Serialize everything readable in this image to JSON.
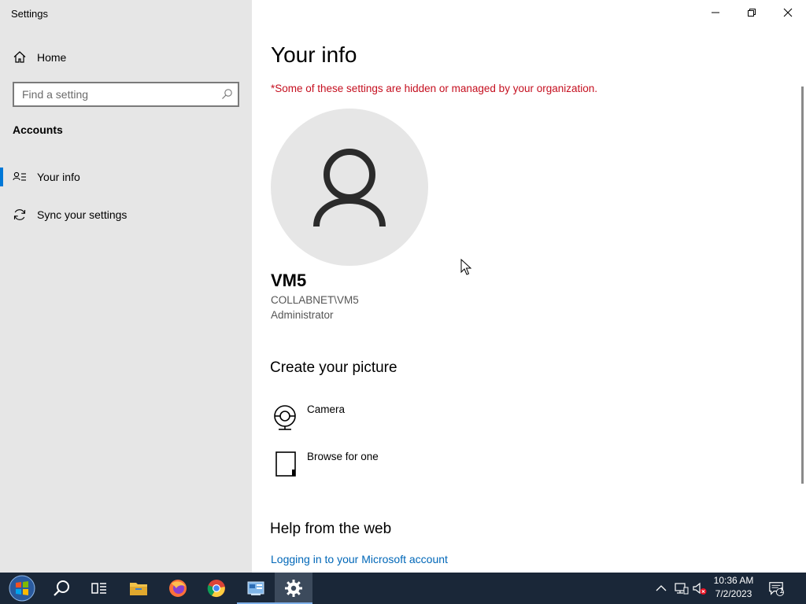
{
  "window": {
    "title": "Settings"
  },
  "sidebar": {
    "home_label": "Home",
    "search_placeholder": "Find a setting",
    "section_title": "Accounts",
    "items": [
      {
        "label": "Your info",
        "icon": "contact-card-icon",
        "active": true
      },
      {
        "label": "Sync your settings",
        "icon": "sync-icon",
        "active": false
      }
    ]
  },
  "main": {
    "title": "Your info",
    "warning": "*Some of these settings are hidden or managed by your organization.",
    "user": {
      "name": "VM5",
      "account": "COLLABNET\\VM5",
      "role": "Administrator"
    },
    "create_picture": {
      "heading": "Create your picture",
      "options": [
        {
          "label": "Camera",
          "icon": "camera-icon"
        },
        {
          "label": "Browse for one",
          "icon": "file-icon"
        }
      ]
    },
    "help": {
      "heading": "Help from the web",
      "link": "Logging in to your Microsoft account"
    }
  },
  "taskbar": {
    "apps": [
      "start-icon",
      "search-icon",
      "task-view-icon",
      "file-explorer-icon",
      "firefox-icon",
      "chrome-icon",
      "control-panel-icon",
      "settings-icon"
    ],
    "clock": {
      "time": "10:36 AM",
      "date": "7/2/2023"
    },
    "notification_count": "1"
  },
  "colors": {
    "accent": "#0078d7",
    "warning": "#c50f1f",
    "link": "#0067b8",
    "taskbar": "#1a2738",
    "sidebar": "#e6e6e6"
  }
}
